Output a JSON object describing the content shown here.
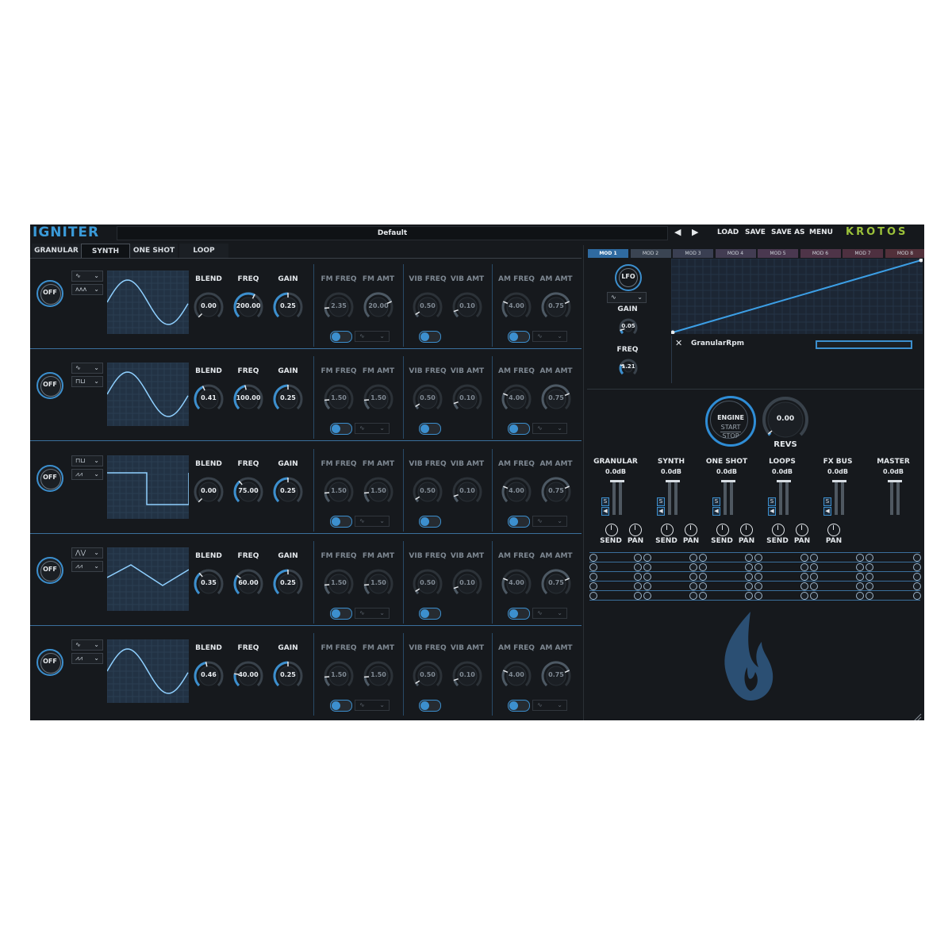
{
  "header": {
    "logo": "IGNITER",
    "preset_name": "Default",
    "prev_label": "◀",
    "next_label": "▶",
    "load_label": "LOAD",
    "save_label": "SAVE",
    "save_as_label": "SAVE AS",
    "menu_label": "MENU",
    "brand": "KROTOS"
  },
  "tabs": [
    {
      "label": "GRANULAR",
      "active": false
    },
    {
      "label": "SYNTH",
      "active": true
    },
    {
      "label": "ONE SHOT",
      "active": false
    },
    {
      "label": "LOOP",
      "active": false
    }
  ],
  "knob_labels": {
    "blend": "BLEND",
    "freq": "FREQ",
    "gain": "GAIN",
    "fm_freq": "FM FREQ",
    "fm_amt": "FM AMT",
    "vib_freq": "VIB FREQ",
    "vib_amt": "VIB AMT",
    "am_freq": "AM FREQ",
    "am_amt": "AM AMT"
  },
  "oscillators": [
    {
      "power": "OFF",
      "wave_shape": "sine",
      "sel1_icon": "∿",
      "sel2_icon": "ʌʌʌ",
      "blend": "0.00",
      "freq": "200.00",
      "gain": "0.25",
      "fm_freq": "2.35",
      "fm_amt": "20.00",
      "vib_freq": "0.50",
      "vib_amt": "0.10",
      "am_freq": "4.00",
      "am_amt": "0.75"
    },
    {
      "power": "OFF",
      "wave_shape": "sine",
      "sel1_icon": "∿",
      "sel2_icon": "⊓⊔",
      "blend": "0.41",
      "freq": "100.00",
      "gain": "0.25",
      "fm_freq": "1.50",
      "fm_amt": "1.50",
      "vib_freq": "0.50",
      "vib_amt": "0.10",
      "am_freq": "4.00",
      "am_amt": "0.75"
    },
    {
      "power": "OFF",
      "wave_shape": "square",
      "sel1_icon": "⊓⊔",
      "sel2_icon": "⩘⩘",
      "blend": "0.00",
      "freq": "75.00",
      "gain": "0.25",
      "fm_freq": "1.50",
      "fm_amt": "1.50",
      "vib_freq": "0.50",
      "vib_amt": "0.10",
      "am_freq": "4.00",
      "am_amt": "0.75"
    },
    {
      "power": "OFF",
      "wave_shape": "triangle",
      "sel1_icon": "⋀⋁",
      "sel2_icon": "⩘⩘",
      "blend": "0.35",
      "freq": "60.00",
      "gain": "0.25",
      "fm_freq": "1.50",
      "fm_amt": "1.50",
      "vib_freq": "0.50",
      "vib_amt": "0.10",
      "am_freq": "4.00",
      "am_amt": "0.75"
    },
    {
      "power": "OFF",
      "wave_shape": "sine",
      "sel1_icon": "∿",
      "sel2_icon": "⩘⩘",
      "blend": "0.46",
      "freq": "40.00",
      "gain": "0.25",
      "fm_freq": "1.50",
      "fm_amt": "1.50",
      "vib_freq": "0.50",
      "vib_amt": "0.10",
      "am_freq": "4.00",
      "am_amt": "0.75"
    }
  ],
  "mod": {
    "tabs": [
      "MOD 1",
      "MOD 2",
      "MOD 3",
      "MOD 4",
      "MOD 5",
      "MOD 6",
      "MOD 7",
      "MOD 8"
    ],
    "active_tab": "MOD 1",
    "lfo_label": "LFO",
    "gain_label": "GAIN",
    "gain_value": "0.05",
    "freq_label": "FREQ",
    "freq_value": "1.21",
    "target": "GranularRpm",
    "close_icon": "✕"
  },
  "engine": {
    "title": "ENGINE",
    "start": "START",
    "stop": "STOP",
    "revs_value": "0.00",
    "revs_label": "REVS"
  },
  "mixer": {
    "channels": [
      {
        "name": "GRANULAR",
        "level": "0.0dB"
      },
      {
        "name": "SYNTH",
        "level": "0.0dB"
      },
      {
        "name": "ONE SHOT",
        "level": "0.0dB"
      },
      {
        "name": "LOOPS",
        "level": "0.0dB"
      },
      {
        "name": "FX BUS",
        "level": "0.0dB"
      },
      {
        "name": "MASTER",
        "level": "0.0dB"
      }
    ],
    "send_label": "SEND",
    "pan_label": "PAN",
    "solo_label": "S",
    "mute_label": "◀"
  },
  "colors": {
    "accent": "#3c8fce",
    "brand": "#9bc13a",
    "background": "#16191d"
  }
}
